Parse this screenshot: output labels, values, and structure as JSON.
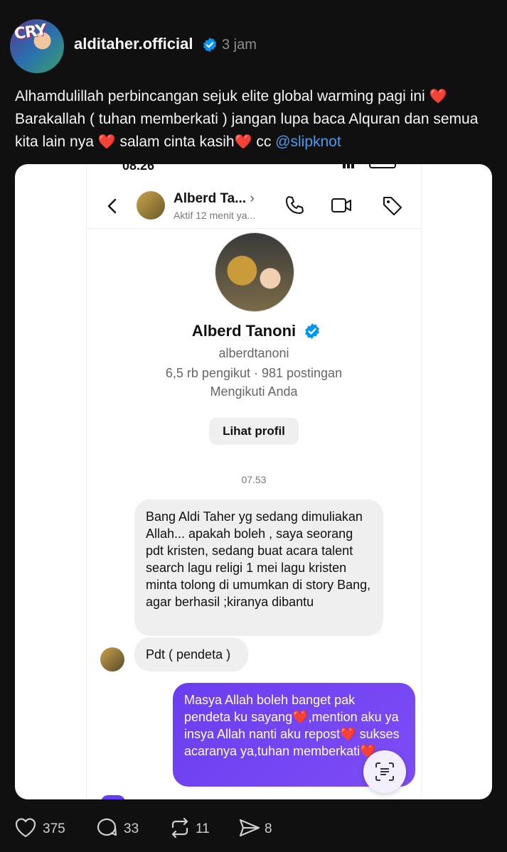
{
  "post": {
    "username": "alditaher.official",
    "time": "3 jam",
    "caption_parts": [
      "Alhamdulillah perbincangan sejuk elite global warming pagi ini",
      "Barakallah ( tuhan memberkati ) jangan lupa baca Alquran dan semua kita lain nya",
      "salam cinta kasih",
      "cc",
      "@slipknot"
    ],
    "heart_glyph": "❤️"
  },
  "screenshot": {
    "status_time": "08.26",
    "header": {
      "name": "Alberd Ta...",
      "status": "Aktif 12 menit ya..."
    },
    "profile": {
      "name": "Alberd Tanoni",
      "handle": "alberdtanoni",
      "stats": "6,5 rb pengikut · 981 postingan",
      "follow_status": "Mengikuti Anda",
      "view_profile": "Lihat profil"
    },
    "timestamp": "07.53",
    "messages": [
      "Bang Aldi Taher yg sedang dimuliakan Allah... apakah boleh , saya seorang pdt kristen, sedang buat acara talent search lagu religi 1 mei lagu kristen minta tolong di umumkan di story Bang, agar berhasil ;kiranya dibantu",
      "Pdt ( pendeta )"
    ],
    "reply_parts": [
      "Masya Allah boleh banget pak pendeta ku sayang",
      ",mention aku ya insya Allah nanti aku repost",
      "sukses acaranya ya,tuhan memberkati"
    ]
  },
  "actions": {
    "likes": "375",
    "comments": "33",
    "reposts": "11",
    "shares": "8"
  },
  "colors": {
    "background": "#101010",
    "link": "#4a9bf0",
    "verified": "#0095f6",
    "bubble_out": "#6a3ef0"
  }
}
